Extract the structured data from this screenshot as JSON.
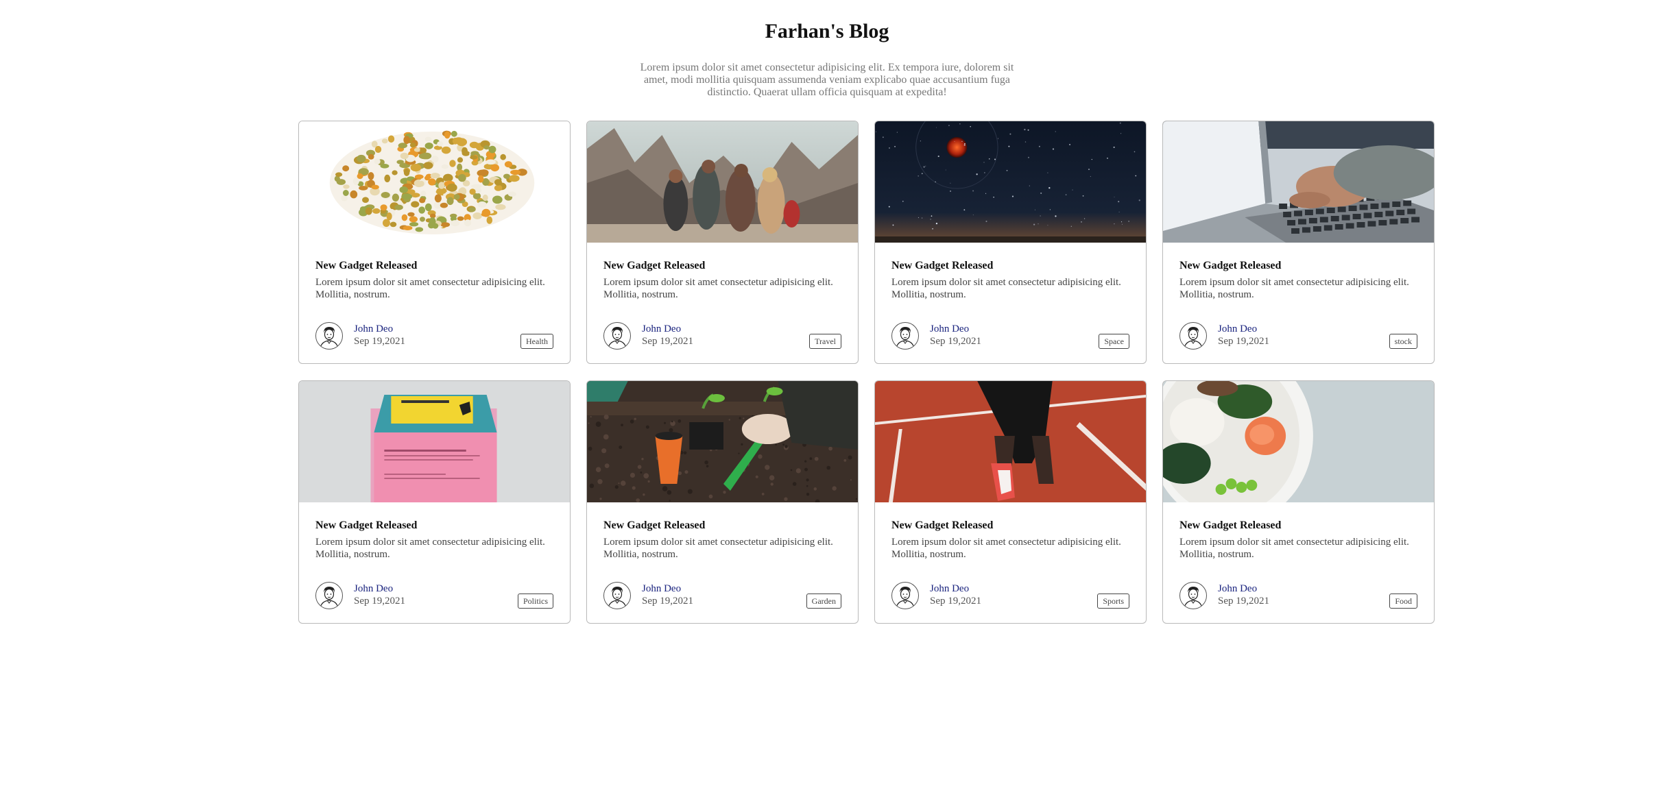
{
  "header": {
    "title": "Farhan's Blog",
    "intro": "Lorem ipsum dolor sit amet consectetur adipisicing elit. Ex tempora iure, dolorem sit amet, modi mollitia quisquam assumenda veniam explicabo quae accusantium fuga distinctio. Quaerat ullam officia quisquam at expedita!"
  },
  "cards": [
    {
      "title": "New Gadget Released",
      "text": "Lorem ipsum dolor sit amet consectetur adipisicing elit. Mollitia, nostrum.",
      "author": "John Deo",
      "date": "Sep 19,2021",
      "tag": "Health",
      "image": "grains-image"
    },
    {
      "title": "New Gadget Released",
      "text": "Lorem ipsum dolor sit amet consectetur adipisicing elit. Mollitia, nostrum.",
      "author": "John Deo",
      "date": "Sep 19,2021",
      "tag": "Travel",
      "image": "hikers-image"
    },
    {
      "title": "New Gadget Released",
      "text": "Lorem ipsum dolor sit amet consectetur adipisicing elit. Mollitia, nostrum.",
      "author": "John Deo",
      "date": "Sep 19,2021",
      "tag": "Space",
      "image": "space-image"
    },
    {
      "title": "New Gadget Released",
      "text": "Lorem ipsum dolor sit amet consectetur adipisicing elit. Mollitia, nostrum.",
      "author": "John Deo",
      "date": "Sep 19,2021",
      "tag": "stock",
      "image": "laptop-image"
    },
    {
      "title": "New Gadget Released",
      "text": "Lorem ipsum dolor sit amet consectetur adipisicing elit. Mollitia, nostrum.",
      "author": "John Deo",
      "date": "Sep 19,2021",
      "tag": "Politics",
      "image": "envelope-image"
    },
    {
      "title": "New Gadget Released",
      "text": "Lorem ipsum dolor sit amet consectetur adipisicing elit. Mollitia, nostrum.",
      "author": "John Deo",
      "date": "Sep 19,2021",
      "tag": "Garden",
      "image": "garden-image"
    },
    {
      "title": "New Gadget Released",
      "text": "Lorem ipsum dolor sit amet consectetur adipisicing elit. Mollitia, nostrum.",
      "author": "John Deo",
      "date": "Sep 19,2021",
      "tag": "Sports",
      "image": "track-image"
    },
    {
      "title": "New Gadget Released",
      "text": "Lorem ipsum dolor sit amet consectetur adipisicing elit. Mollitia, nostrum.",
      "author": "John Deo",
      "date": "Sep 19,2021",
      "tag": "Food",
      "image": "food-bowl-image"
    }
  ],
  "colors": {
    "author_link": "#1a237e",
    "card_border": "#b9b9b9",
    "intro_text": "#777777"
  }
}
